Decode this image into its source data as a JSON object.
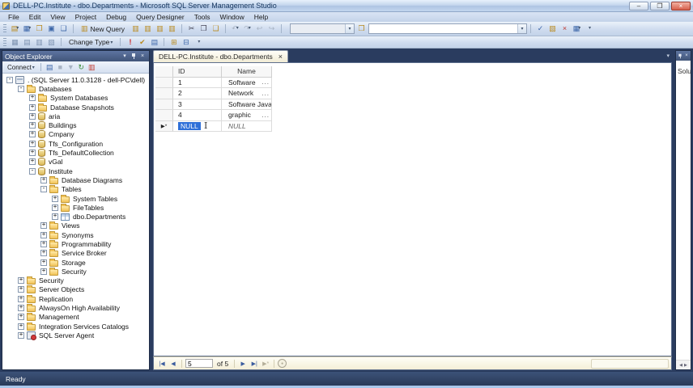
{
  "window": {
    "title": "DELL-PC.Institute - dbo.Departments - Microsoft SQL Server Management Studio",
    "controls": {
      "minimize": "–",
      "restore": "❐",
      "close": "×"
    }
  },
  "menu": {
    "items": [
      "File",
      "Edit",
      "View",
      "Project",
      "Debug",
      "Query Designer",
      "Tools",
      "Window",
      "Help"
    ]
  },
  "toolbar_standard": {
    "file_icons": [
      {
        "name": "new-connection-icon",
        "glyph": "▤",
        "mod": "gold",
        "dd": "▾"
      },
      {
        "name": "window-layout-icon",
        "glyph": "▦",
        "mod": "blue",
        "dd": "▾"
      },
      {
        "name": "open-file-icon",
        "glyph": "❒",
        "mod": "gold"
      },
      {
        "name": "save-icon",
        "glyph": "▣",
        "mod": "blue"
      },
      {
        "name": "save-all-icon",
        "glyph": "❏",
        "mod": "blue"
      }
    ],
    "new_query_label": "New Query",
    "new_query_glyph": "▥",
    "query_icons": [
      {
        "name": "database-engine-query-icon",
        "glyph": "▥",
        "mod": "gold"
      },
      {
        "name": "analysis-services-mdx-query-icon",
        "glyph": "▥",
        "mod": "gold"
      },
      {
        "name": "analysis-services-dmx-query-icon",
        "glyph": "▥",
        "mod": "gold"
      },
      {
        "name": "analysis-services-xmla-query-icon",
        "glyph": "▥",
        "mod": "gold"
      }
    ],
    "edit_icons": [
      {
        "name": "cut-icon",
        "glyph": "✂",
        "mod": "dark"
      },
      {
        "name": "copy-icon",
        "glyph": "❐",
        "mod": "dark"
      },
      {
        "name": "paste-icon",
        "glyph": "❑",
        "mod": "gold"
      }
    ],
    "history_icons": [
      {
        "name": "undo-icon",
        "glyph": "↶",
        "mod": "dis",
        "dd": "▾"
      },
      {
        "name": "redo-icon",
        "glyph": "↷",
        "mod": "dis",
        "dd": "▾"
      },
      {
        "name": "navigate-back-icon",
        "glyph": "↩",
        "mod": "dis"
      },
      {
        "name": "navigate-forward-icon",
        "glyph": "↪",
        "mod": "dis"
      }
    ],
    "combo1_value": "",
    "folder_icon": {
      "name": "browse-folder-icon",
      "glyph": "❒",
      "mod": "gold"
    },
    "combo2_value": "",
    "combo_dd": "▾",
    "right_icons": [
      {
        "name": "parse-query-icon",
        "glyph": "✓",
        "mod": "blue"
      },
      {
        "name": "execution-plan-icon",
        "glyph": "▧",
        "mod": "gold"
      },
      {
        "name": "cancel-executing-query-icon",
        "glyph": "×",
        "mod": "red"
      },
      {
        "name": "query-options-icon",
        "glyph": "▦",
        "mod": "blue",
        "dd": "▾"
      }
    ],
    "overflow": "▾"
  },
  "toolbar_query_designer": {
    "pane_icons": [
      {
        "name": "show-diagram-pane-icon",
        "glyph": "▦",
        "mod": "pane"
      },
      {
        "name": "show-criteria-pane-icon",
        "glyph": "▤",
        "mod": "pane"
      },
      {
        "name": "show-sql-pane-icon",
        "glyph": "▥",
        "mod": "pane"
      },
      {
        "name": "show-results-pane-icon",
        "glyph": "▧",
        "mod": "pane"
      }
    ],
    "change_type_label": "Change Type",
    "change_type_dd": "▾",
    "action_icons": [
      {
        "name": "execute-sql-icon",
        "glyph": "!",
        "mod": "exec"
      },
      {
        "name": "verify-sql-icon",
        "glyph": "✔",
        "mod": "gold"
      },
      {
        "name": "add-group-by-icon",
        "glyph": "▤",
        "mod": "blue"
      }
    ],
    "table_icons": [
      {
        "name": "add-table-icon",
        "glyph": "⊞",
        "mod": "gold"
      },
      {
        "name": "add-derived-table-icon",
        "glyph": "⊟",
        "mod": "blue"
      }
    ],
    "overflow": "▾"
  },
  "object_explorer": {
    "title": "Object Explorer",
    "caption_menu": "▾",
    "caption_close": "×",
    "connect_label": "Connect",
    "connect_dd": "▾",
    "toolbar_icons": [
      {
        "name": "disconnect-icon",
        "glyph": "▤",
        "mod": "blue"
      },
      {
        "name": "stop-icon",
        "glyph": "■",
        "mod": "dis"
      },
      {
        "name": "filter-icon",
        "glyph": "▼",
        "mod": "dis"
      },
      {
        "name": "refresh-icon",
        "glyph": "↻",
        "mod": "green"
      },
      {
        "name": "reports-icon",
        "glyph": "▥",
        "mod": "red"
      }
    ],
    "tree": [
      {
        "label": ". (SQL Server 11.0.3128 - dell-PC\\dell)",
        "level": 0,
        "expand": "-",
        "icon": "server"
      },
      {
        "label": "Databases",
        "level": 1,
        "expand": "-",
        "icon": "folder"
      },
      {
        "label": "System Databases",
        "level": 2,
        "expand": "+",
        "icon": "folder"
      },
      {
        "label": "Database Snapshots",
        "level": 2,
        "expand": "+",
        "icon": "folder"
      },
      {
        "label": "aria",
        "level": 2,
        "expand": "+",
        "icon": "db"
      },
      {
        "label": "Buildings",
        "level": 2,
        "expand": "+",
        "icon": "db"
      },
      {
        "label": "Cmpany",
        "level": 2,
        "expand": "+",
        "icon": "db"
      },
      {
        "label": "Tfs_Configuration",
        "level": 2,
        "expand": "+",
        "icon": "db"
      },
      {
        "label": "Tfs_DefaultCollection",
        "level": 2,
        "expand": "+",
        "icon": "db"
      },
      {
        "label": "vGal",
        "level": 2,
        "expand": "+",
        "icon": "db"
      },
      {
        "label": "Institute",
        "level": 2,
        "expand": "-",
        "icon": "db"
      },
      {
        "label": "Database Diagrams",
        "level": 3,
        "expand": "+",
        "icon": "folder"
      },
      {
        "label": "Tables",
        "level": 3,
        "expand": "-",
        "icon": "folder"
      },
      {
        "label": "System Tables",
        "level": 4,
        "expand": "+",
        "icon": "folder"
      },
      {
        "label": "FileTables",
        "level": 4,
        "expand": "+",
        "icon": "folder"
      },
      {
        "label": "dbo.Departments",
        "level": 4,
        "expand": "+",
        "icon": "table"
      },
      {
        "label": "Views",
        "level": 3,
        "expand": "+",
        "icon": "folder"
      },
      {
        "label": "Synonyms",
        "level": 3,
        "expand": "+",
        "icon": "folder"
      },
      {
        "label": "Programmability",
        "level": 3,
        "expand": "+",
        "icon": "folder"
      },
      {
        "label": "Service Broker",
        "level": 3,
        "expand": "+",
        "icon": "folder"
      },
      {
        "label": "Storage",
        "level": 3,
        "expand": "+",
        "icon": "folder"
      },
      {
        "label": "Security",
        "level": 3,
        "expand": "+",
        "icon": "folder"
      },
      {
        "label": "Security",
        "level": 1,
        "expand": "+",
        "icon": "folder"
      },
      {
        "label": "Server Objects",
        "level": 1,
        "expand": "+",
        "icon": "folder"
      },
      {
        "label": "Replication",
        "level": 1,
        "expand": "+",
        "icon": "folder"
      },
      {
        "label": "AlwaysOn High Availability",
        "level": 1,
        "expand": "+",
        "icon": "folder"
      },
      {
        "label": "Management",
        "level": 1,
        "expand": "+",
        "icon": "folder"
      },
      {
        "label": "Integration Services Catalogs",
        "level": 1,
        "expand": "+",
        "icon": "folder"
      },
      {
        "label": "SQL Server Agent",
        "level": 1,
        "expand": "+",
        "icon": "agent"
      }
    ]
  },
  "document": {
    "tab_title": "DELL-PC.Institute - dbo.Departments",
    "tab_close": "×",
    "tab_list_chevron": "▾",
    "grid": {
      "col_id": "ID",
      "col_name": "Name",
      "rows": [
        {
          "id": "1",
          "name": "Software",
          "more": "..."
        },
        {
          "id": "2",
          "name": "Network",
          "more": "..."
        },
        {
          "id": "3",
          "name": "Software Java",
          "more": "..."
        },
        {
          "id": "4",
          "name": "graphic",
          "more": "..."
        }
      ],
      "new_row": {
        "indicator": "▶*",
        "id": "NULL",
        "name": "NULL"
      }
    },
    "navigator": {
      "first": "|◀",
      "prev": "◀",
      "current": "5",
      "of_label": "of 5",
      "next": "▶",
      "last": "▶|",
      "new_row": "▶*",
      "stop": "●"
    }
  },
  "solution_panel": {
    "title_clipped": "Solut",
    "close": "×",
    "scroll_left": "◀",
    "scroll_right": "▶"
  },
  "status_bar": {
    "text": "Ready"
  },
  "colors": {
    "selection": "#2f70d8",
    "mdi_background": "#2a3c5f",
    "tab_cream": "#f1ebd5",
    "caption_blue": "#415579"
  }
}
